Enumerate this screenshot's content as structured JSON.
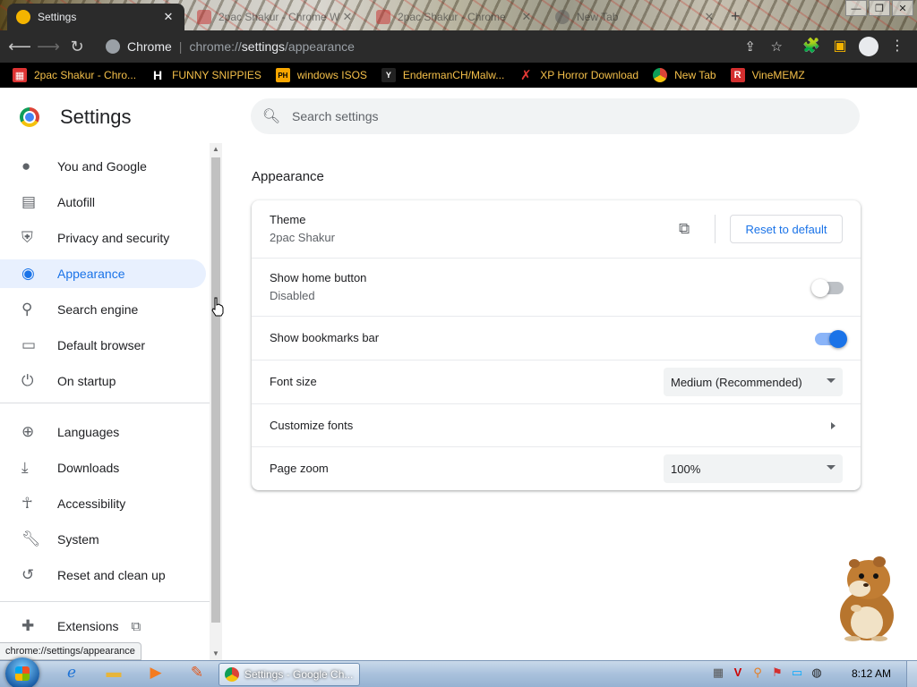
{
  "browser": {
    "tabs": [
      {
        "title": "Settings",
        "active": true,
        "favicon": "gear-icon"
      },
      {
        "title": "2pac Shakur - Chrome W",
        "active": false,
        "favicon": "custom-favicon"
      },
      {
        "title": "2pac Shakur - Chrome",
        "active": false,
        "favicon": "custom-favicon"
      },
      {
        "title": "New Tab",
        "active": false,
        "favicon": "chrome-icon"
      }
    ],
    "new_tab_label": "+",
    "omnibox": {
      "site_label": "Chrome",
      "url_prefix": "chrome://",
      "url_main": "settings",
      "url_suffix": "/appearance"
    },
    "bookmarks": [
      {
        "label": "2pac Shakur - Chro...",
        "icon": "store-icon",
        "icon_color": "#d33"
      },
      {
        "label": "FUNNY SNIPPIES",
        "icon": "H",
        "icon_color": "#ffffff"
      },
      {
        "label": "windows ISOS",
        "icon": "PH",
        "icon_color": "#f7a600"
      },
      {
        "label": "EndermanCH/Malw...",
        "icon": "Y",
        "icon_color": "#ffffff"
      },
      {
        "label": "XP Horror Download",
        "icon": "X",
        "icon_color": "#e53935"
      },
      {
        "label": "New Tab",
        "icon": "chrome-icon",
        "icon_color": "#c0c0c0"
      },
      {
        "label": "VineMEMZ",
        "icon": "R",
        "icon_color": "#d32f2f"
      }
    ]
  },
  "settings": {
    "title": "Settings",
    "search_placeholder": "Search settings",
    "sidebar": {
      "items": [
        {
          "label": "You and Google",
          "icon": "person-icon",
          "glyph": "👤",
          "active": false
        },
        {
          "label": "Autofill",
          "icon": "clipboard-icon",
          "glyph": "📋",
          "active": false
        },
        {
          "label": "Privacy and security",
          "icon": "shield-icon",
          "glyph": "⛨",
          "active": false
        },
        {
          "label": "Appearance",
          "icon": "palette-icon",
          "glyph": "🎨",
          "active": true
        },
        {
          "label": "Search engine",
          "icon": "search-icon",
          "glyph": "🔍",
          "active": false
        },
        {
          "label": "Default browser",
          "icon": "browser-icon",
          "glyph": "▭",
          "active": false
        },
        {
          "label": "On startup",
          "icon": "power-icon",
          "glyph": "⏻",
          "active": false
        },
        {
          "label": "Languages",
          "icon": "globe-icon",
          "glyph": "🌐",
          "active": false
        },
        {
          "label": "Downloads",
          "icon": "download-icon",
          "glyph": "⭳",
          "active": false
        },
        {
          "label": "Accessibility",
          "icon": "accessibility-icon",
          "glyph": "♿",
          "active": false
        },
        {
          "label": "System",
          "icon": "wrench-icon",
          "glyph": "🔧",
          "active": false
        },
        {
          "label": "Reset and clean up",
          "icon": "history-icon",
          "glyph": "↺",
          "active": false
        },
        {
          "label": "Extensions",
          "icon": "puzzle-icon",
          "glyph": "🧩",
          "active": false
        }
      ]
    },
    "appearance": {
      "section_title": "Appearance",
      "theme": {
        "label": "Theme",
        "value": "2pac Shakur",
        "reset_label": "Reset to default"
      },
      "home_button": {
        "label": "Show home button",
        "status": "Disabled",
        "enabled": false
      },
      "bookmarks_bar": {
        "label": "Show bookmarks bar",
        "enabled": true
      },
      "font_size": {
        "label": "Font size",
        "selected": "Medium (Recommended)"
      },
      "customize_fonts": {
        "label": "Customize fonts"
      },
      "page_zoom": {
        "label": "Page zoom",
        "selected": "100%"
      }
    },
    "status_url": "chrome://settings/appearance"
  },
  "taskbar": {
    "task_label": "Settings - Google Ch...",
    "clock": "8:12 AM",
    "pinned": [
      "internet-explorer-icon",
      "folder-icon",
      "media-player-icon",
      "paint-icon"
    ],
    "tray": [
      "network-icon",
      "antivirus-icon",
      "search-icon",
      "flag-icon",
      "display-icon",
      "clock-icon"
    ]
  },
  "colors": {
    "accent": "#1a73e8",
    "active_bg": "#e8f0fe",
    "bookmark_text": "#f5c04a"
  }
}
